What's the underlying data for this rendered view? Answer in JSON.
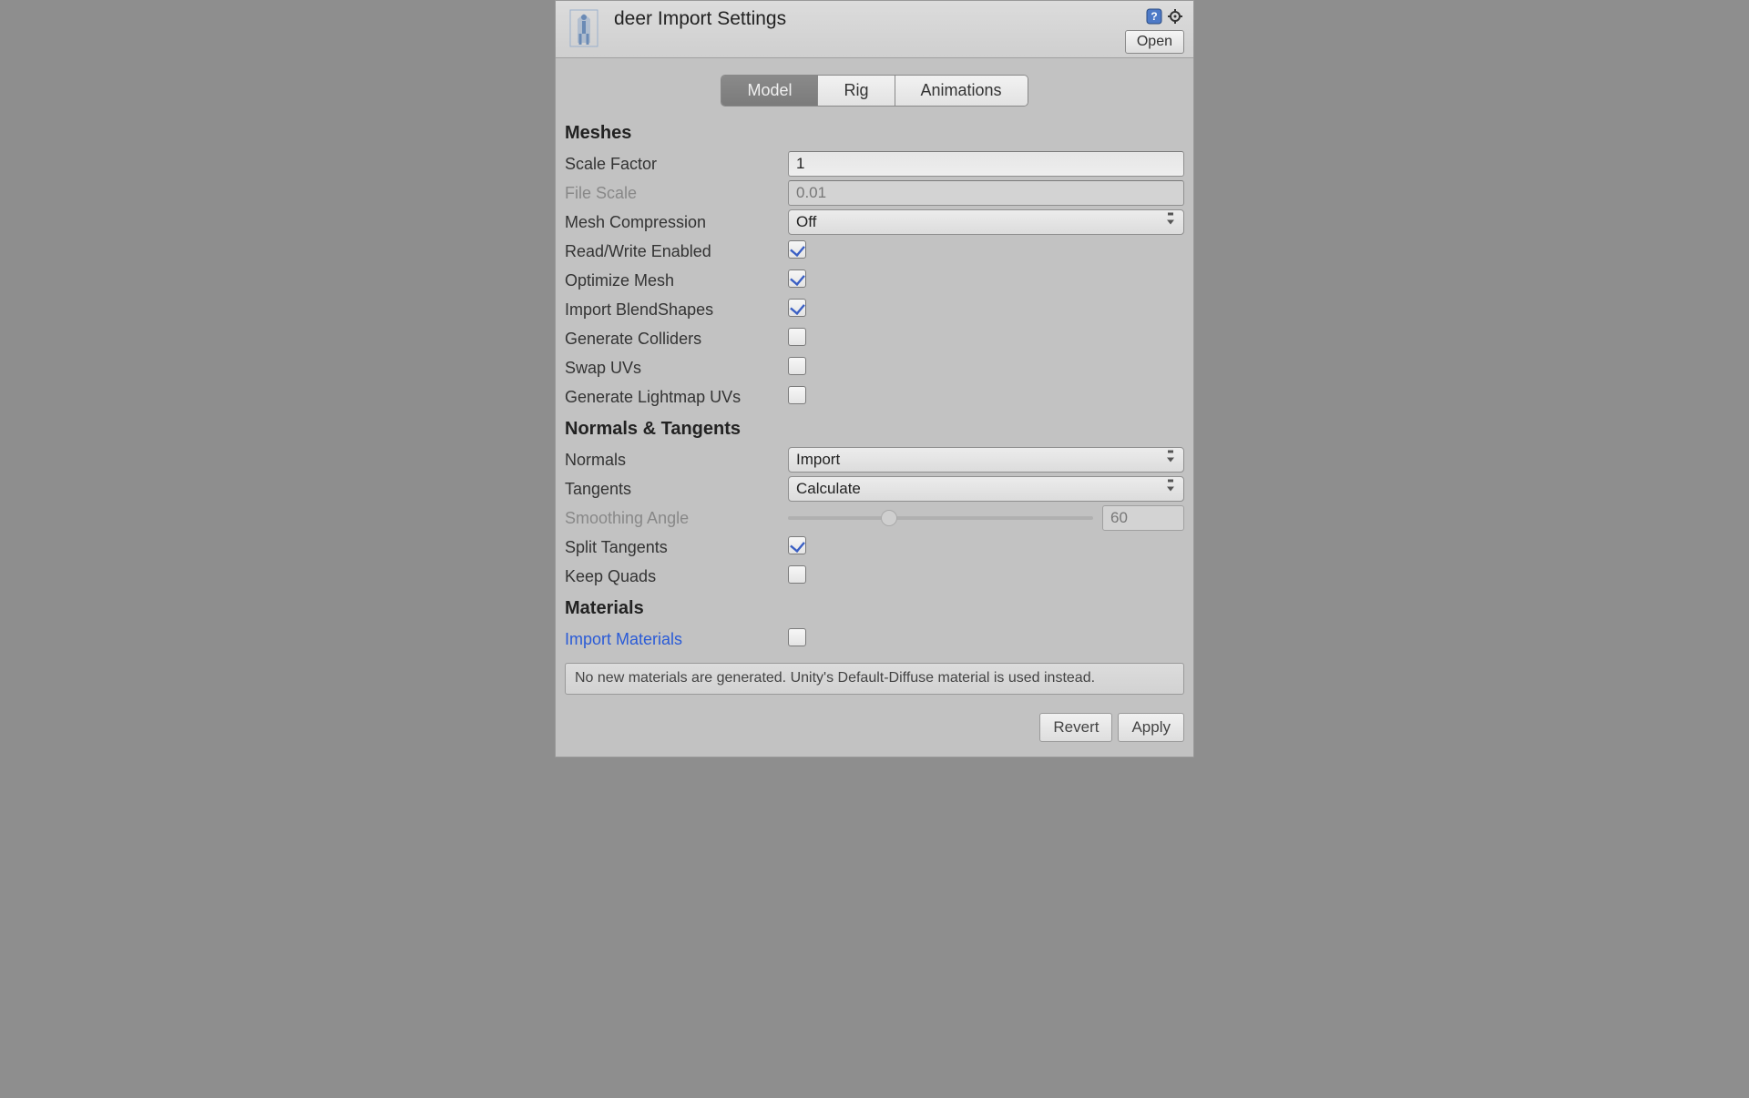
{
  "header": {
    "title": "deer Import Settings",
    "open_label": "Open"
  },
  "tabs": {
    "model": "Model",
    "rig": "Rig",
    "animations": "Animations",
    "active": "model"
  },
  "sections": {
    "meshes": "Meshes",
    "normals_tangents": "Normals & Tangents",
    "materials": "Materials"
  },
  "fields": {
    "scale_factor": {
      "label": "Scale Factor",
      "value": "1"
    },
    "file_scale": {
      "label": "File Scale",
      "value": "0.01",
      "disabled": true
    },
    "mesh_compression": {
      "label": "Mesh Compression",
      "value": "Off"
    },
    "read_write": {
      "label": "Read/Write Enabled",
      "checked": true
    },
    "optimize_mesh": {
      "label": "Optimize Mesh",
      "checked": true
    },
    "import_blendshapes": {
      "label": "Import BlendShapes",
      "checked": true
    },
    "generate_colliders": {
      "label": "Generate Colliders",
      "checked": false
    },
    "swap_uvs": {
      "label": "Swap UVs",
      "checked": false
    },
    "generate_lightmap_uvs": {
      "label": "Generate Lightmap UVs",
      "checked": false
    },
    "normals": {
      "label": "Normals",
      "value": "Import"
    },
    "tangents": {
      "label": "Tangents",
      "value": "Calculate"
    },
    "smoothing_angle": {
      "label": "Smoothing Angle",
      "value": "60",
      "percent": 33,
      "disabled": true
    },
    "split_tangents": {
      "label": "Split Tangents",
      "checked": true
    },
    "keep_quads": {
      "label": "Keep Quads",
      "checked": false
    },
    "import_materials": {
      "label": "Import Materials",
      "checked": false
    }
  },
  "info_box": "No new materials are generated. Unity's Default-Diffuse material is used instead.",
  "footer": {
    "revert": "Revert",
    "apply": "Apply"
  }
}
